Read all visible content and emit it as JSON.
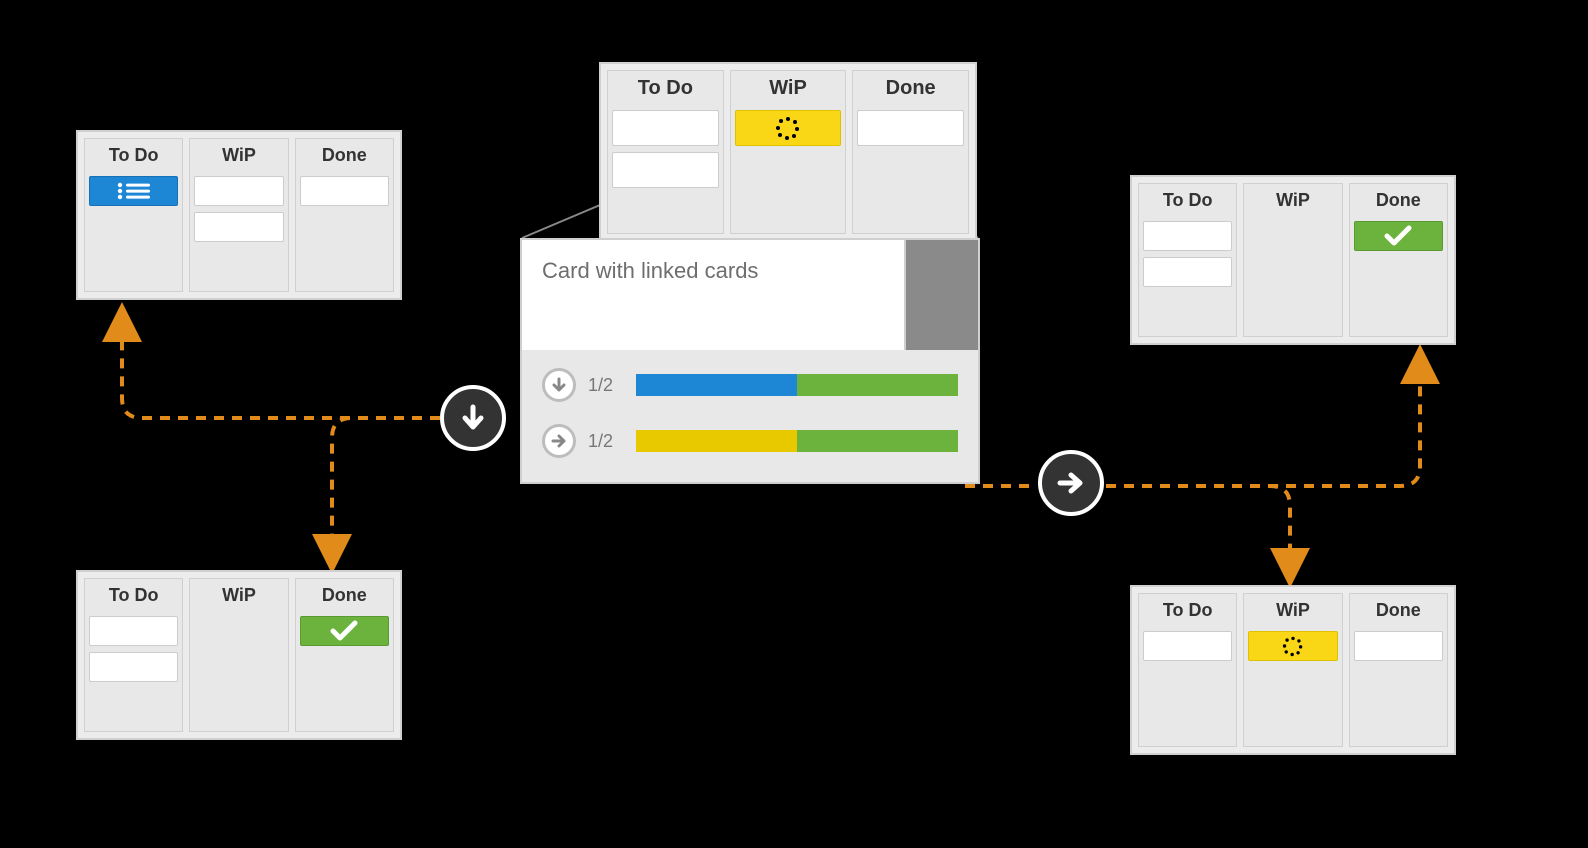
{
  "columns": {
    "todo": "To Do",
    "wip": "WiP",
    "done": "Done"
  },
  "detail": {
    "title": "Card with linked cards",
    "rows": [
      {
        "dir": "down",
        "frac": "1/2",
        "segments": [
          {
            "color": "blue",
            "pct": 50
          },
          {
            "color": "green",
            "pct": 50
          }
        ]
      },
      {
        "dir": "right",
        "frac": "1/2",
        "segments": [
          {
            "color": "yellow",
            "pct": 50
          },
          {
            "color": "green",
            "pct": 50
          }
        ]
      }
    ]
  },
  "boards": {
    "top": {
      "todo_cards": [
        "blank",
        "blank"
      ],
      "wip_cards": [
        "yellow-loading"
      ],
      "done_cards": [
        "blank"
      ]
    },
    "tl": {
      "todo_cards": [
        "blue-list"
      ],
      "wip_cards": [
        "blank",
        "blank"
      ],
      "done_cards": [
        "blank"
      ]
    },
    "bl": {
      "todo_cards": [
        "blank",
        "blank"
      ],
      "wip_cards": [],
      "done_cards": [
        "green-check"
      ]
    },
    "tr": {
      "todo_cards": [
        "blank",
        "blank"
      ],
      "wip_cards": [],
      "done_cards": [
        "green-check"
      ]
    },
    "br": {
      "todo_cards": [
        "blank"
      ],
      "wip_cards": [
        "yellow-loading"
      ],
      "done_cards": [
        "blank"
      ]
    }
  },
  "colors": {
    "blue": "#1d87d6",
    "green": "#6cb33e",
    "yellow": "#f9d616",
    "arrow": "#e08b1a",
    "badge_bg": "#333333"
  }
}
